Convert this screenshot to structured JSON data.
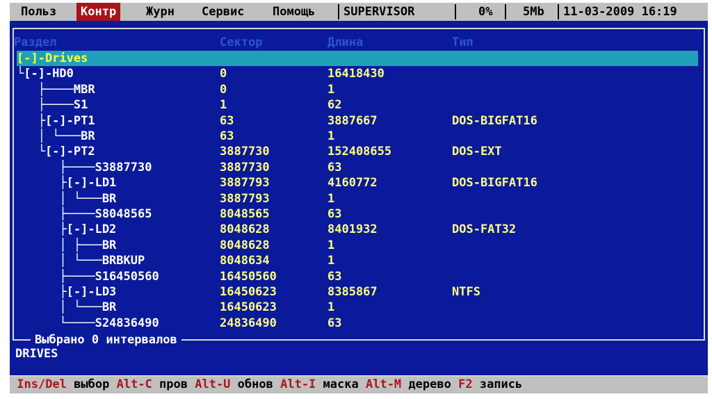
{
  "menubar": {
    "items": [
      {
        "label": "Польз",
        "active": false
      },
      {
        "label": "Контр",
        "active": true
      },
      {
        "label": "Журн",
        "active": false
      },
      {
        "label": "Сервис",
        "active": false
      },
      {
        "label": "Помощь",
        "active": false
      }
    ],
    "user": "SUPERVISOR",
    "percent": "0%",
    "memory": "5Mb",
    "datetime": "11-03-2009 16:19"
  },
  "table": {
    "headers": {
      "section": "Раздел",
      "sector": "Сектор",
      "length": "Длина",
      "type": "Тип"
    },
    "rows": [
      {
        "name": "[-]-Drives",
        "sector": "",
        "length": "",
        "type": "",
        "selected": true
      },
      {
        "name": "└[-]-HD0",
        "sector": "0",
        "length": "16418430",
        "type": ""
      },
      {
        "name": "   ├────MBR",
        "sector": "0",
        "length": "1",
        "type": ""
      },
      {
        "name": "   ├────S1",
        "sector": "1",
        "length": "62",
        "type": ""
      },
      {
        "name": "   ├[-]-PT1",
        "sector": "63",
        "length": "3887667",
        "type": "DOS-BIGFAT16"
      },
      {
        "name": "   │ └───BR",
        "sector": "63",
        "length": "1",
        "type": ""
      },
      {
        "name": "   └[-]-PT2",
        "sector": "3887730",
        "length": "152408655",
        "type": "DOS-EXT"
      },
      {
        "name": "      ├────S3887730",
        "sector": "3887730",
        "length": "63",
        "type": ""
      },
      {
        "name": "      ├[-]-LD1",
        "sector": "3887793",
        "length": "4160772",
        "type": "DOS-BIGFAT16"
      },
      {
        "name": "      │ └───BR",
        "sector": "3887793",
        "length": "1",
        "type": ""
      },
      {
        "name": "      ├────S8048565",
        "sector": "8048565",
        "length": "63",
        "type": ""
      },
      {
        "name": "      ├[-]-LD2",
        "sector": "8048628",
        "length": "8401932",
        "type": "DOS-FAT32"
      },
      {
        "name": "      │ ├───BR",
        "sector": "8048628",
        "length": "1",
        "type": ""
      },
      {
        "name": "      │ └───BRBKUP",
        "sector": "8048634",
        "length": "1",
        "type": ""
      },
      {
        "name": "      ├────S16450560",
        "sector": "16450560",
        "length": "63",
        "type": ""
      },
      {
        "name": "      ├[-]-LD3",
        "sector": "16450623",
        "length": "8385867",
        "type": "NTFS"
      },
      {
        "name": "      │ └───BR",
        "sector": "16450623",
        "length": "1",
        "type": ""
      },
      {
        "name": "      └────S24836490",
        "sector": "24836490",
        "length": "63",
        "type": ""
      }
    ]
  },
  "status": {
    "selected_text": "Выбрано 0 интервалов",
    "current_path": "DRIVES"
  },
  "hints": [
    {
      "key": "Ins/Del",
      "label": "выбор"
    },
    {
      "key": "Alt-C",
      "label": "пров"
    },
    {
      "key": "Alt-U",
      "label": "обнов"
    },
    {
      "key": "Alt-I",
      "label": "маска"
    },
    {
      "key": "Alt-M",
      "label": "дерево"
    },
    {
      "key": "F2",
      "label": "запись"
    }
  ],
  "colors": {
    "panel_bg": "#0a1a9a",
    "selection_bg": "#20a0b8",
    "value_text": "#ffff80",
    "key_text": "#b0141a",
    "bar_bg": "#c0c0c0"
  }
}
